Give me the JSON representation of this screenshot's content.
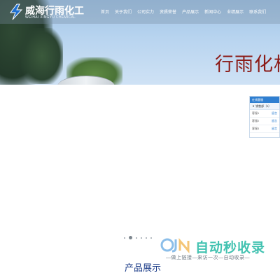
{
  "header": {
    "brand_cn": "威海行雨化工",
    "brand_en": "WEIHAI XINGYU CHEMICAL"
  },
  "nav": [
    {
      "label": "首页"
    },
    {
      "label": "关于我们"
    },
    {
      "label": "公司实力"
    },
    {
      "label": "资质荣誉"
    },
    {
      "label": "产品展示"
    },
    {
      "label": "新闻中心"
    },
    {
      "label": "业绩展示"
    },
    {
      "label": "联系我们"
    }
  ],
  "hero": {
    "title": "行雨化机"
  },
  "service": {
    "title": "在线客服",
    "dept": "▼ 销售部（3）",
    "rows": [
      {
        "name": "客服1",
        "action": "留言"
      },
      {
        "name": "客服2",
        "action": "留言"
      },
      {
        "name": "客服3",
        "action": "留言"
      }
    ]
  },
  "slider": {
    "count": 6,
    "active": 1
  },
  "section": {
    "title": "产品展示"
  },
  "watermark": {
    "main": "自动秒收录",
    "sub": "—做上链接—来访一次—自动收录—"
  },
  "colors": {
    "hero_title": "#8b1b17",
    "section_title": "#1f3f8a",
    "service_header": "#2f7fd1",
    "watermark": "#22b8a4"
  }
}
